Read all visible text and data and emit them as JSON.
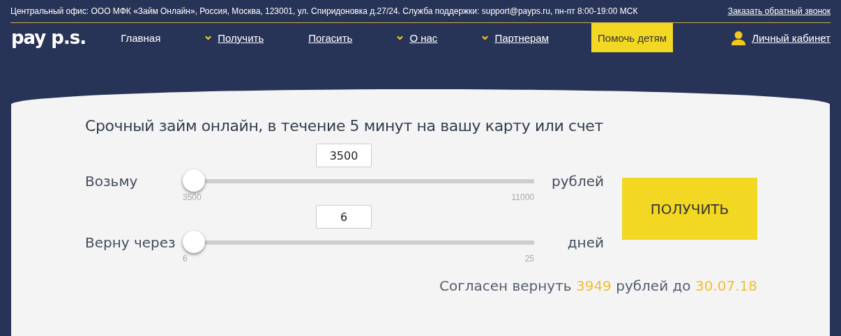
{
  "top_bar": {
    "address": "Центральный офис: ООО МФК «Займ Онлайн», Россия, Москва, 123001, ул. Спиридоновка д.27/24. Служба поддержки: support@payps.ru, пн-пт 8:00-19:00 МСК",
    "callback_link": "Заказать обратный звонок"
  },
  "logo": "pay p.s.",
  "nav": {
    "items": [
      {
        "label": "Главная",
        "kind": "link",
        "dropdown": false,
        "selected": true
      },
      {
        "label": "Получить",
        "kind": "link",
        "dropdown": true,
        "selected": false
      },
      {
        "label": "Погасить",
        "kind": "link",
        "dropdown": false,
        "selected": false
      },
      {
        "label": "О нас",
        "kind": "link",
        "dropdown": true,
        "selected": false
      },
      {
        "label": "Партнерам",
        "kind": "link",
        "dropdown": true,
        "selected": false
      },
      {
        "label": "Помочь детям",
        "kind": "highlight",
        "selected": false
      }
    ],
    "account_link": "Личный кабинет"
  },
  "calculator": {
    "title": "Срочный займ онлайн, в течение 5 минут на вашу карту или счет",
    "sliders": [
      {
        "label": "Возьму",
        "value": "3500",
        "unit": "рублей",
        "min": "3500",
        "max": "11000",
        "level": 0
      },
      {
        "label": "Верну через",
        "value": "6",
        "unit": "дней",
        "min": "6",
        "max": "25",
        "level": 0
      }
    ],
    "submit": "ПОЛУЧИТЬ",
    "summary": [
      {
        "text": "Согласен вернуть",
        "highlight": false
      },
      {
        "text": "3949",
        "highlight": true
      },
      {
        "text": "рублей до",
        "highlight": false
      },
      {
        "text": "30.07.18",
        "highlight": true
      }
    ]
  }
}
